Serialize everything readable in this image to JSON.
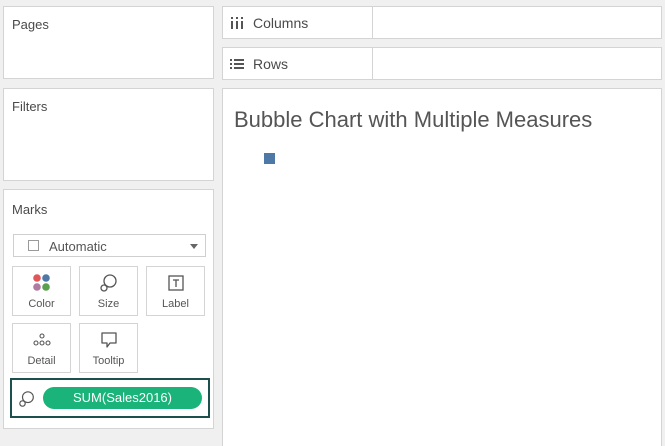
{
  "pages": {
    "title": "Pages"
  },
  "filters": {
    "title": "Filters"
  },
  "marks": {
    "title": "Marks",
    "mark_type": "Automatic",
    "buttons": [
      {
        "label": "Color",
        "icon": "color-dots-icon"
      },
      {
        "label": "Size",
        "icon": "size-icon"
      },
      {
        "label": "Label",
        "icon": "label-icon"
      },
      {
        "label": "Detail",
        "icon": "detail-dots-icon"
      },
      {
        "label": "Tooltip",
        "icon": "tooltip-icon"
      }
    ],
    "pill": {
      "label": "SUM(Sales2016)",
      "icon": "size-icon",
      "color": "#1ab37a"
    }
  },
  "shelves": {
    "columns": {
      "label": "Columns",
      "icon": "columns-icon"
    },
    "rows": {
      "label": "Rows",
      "icon": "rows-icon"
    }
  },
  "view": {
    "title": "Bubble Chart with Multiple Measures",
    "mark_color": "#4e79a7"
  },
  "colors": {
    "color_dots": [
      "#e15759",
      "#4e79a7",
      "#b07aa1",
      "#59a14f"
    ],
    "pill_border": "#1d4f4c"
  }
}
